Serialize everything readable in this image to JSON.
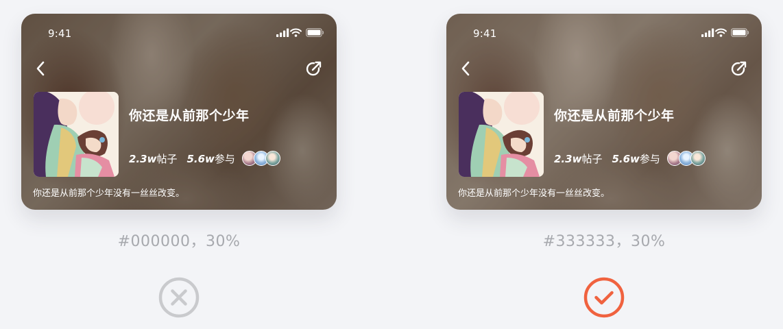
{
  "panels": [
    {
      "id": "left",
      "card": {
        "status_time": "9:41",
        "title": "你还是从前那个少年",
        "posts_num": "2.3w",
        "posts_label": "帖子",
        "participants_num": "5.6w",
        "participants_label": "参与",
        "description": "你还是从前那个少年没有一丝丝改变。"
      },
      "overlay_color": "#000000",
      "caption": "#000000，30%",
      "verdict": "wrong",
      "verdict_icon": "circle-x-icon",
      "verdict_color": "#c9cacd"
    },
    {
      "id": "right",
      "card": {
        "status_time": "9:41",
        "title": "你还是从前那个少年",
        "posts_num": "2.3w",
        "posts_label": "帖子",
        "participants_num": "5.6w",
        "participants_label": "参与",
        "description": "你还是从前那个少年没有一丝丝改变。"
      },
      "overlay_color": "#333333",
      "caption": "#333333，30%",
      "verdict": "correct",
      "verdict_icon": "circle-check-icon",
      "verdict_color": "#f0623f"
    }
  ]
}
